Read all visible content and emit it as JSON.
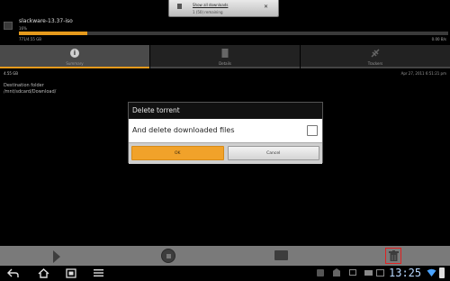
{
  "notification": {
    "title": "Show all downloads",
    "subtitle": "1 (50) remaining",
    "close": "✕"
  },
  "torrent": {
    "name": "slackware-13.37-iso",
    "percent": "16%",
    "size_progress": "771/4.55 GB",
    "speed": "0.00 B/s",
    "progress_fraction": 0.16
  },
  "tabs": [
    {
      "label": "Summary",
      "icon": "info-icon",
      "active": true
    },
    {
      "label": "Details",
      "icon": "details-icon",
      "active": false
    },
    {
      "label": "Trackers",
      "icon": "trackers-icon",
      "active": false
    }
  ],
  "summary": {
    "size": "4.55 GB",
    "date": "Apr 27, 2011 6:51:21 pm",
    "destination_label": "Destination folder",
    "destination_value": "/mnt/sdcard/Download/"
  },
  "dialog": {
    "title": "Delete torrent",
    "checkbox_label": "And delete downloaded files",
    "checkbox_checked": false,
    "ok_label": "OK",
    "cancel_label": "Cancel"
  },
  "action_bar": {
    "icons": [
      "play-icon",
      "stop-icon",
      "queue-icon",
      "trash-icon"
    ]
  },
  "status": {
    "time": "13:25"
  },
  "colors": {
    "accent": "#f1a22a",
    "highlight": "#e02020"
  }
}
